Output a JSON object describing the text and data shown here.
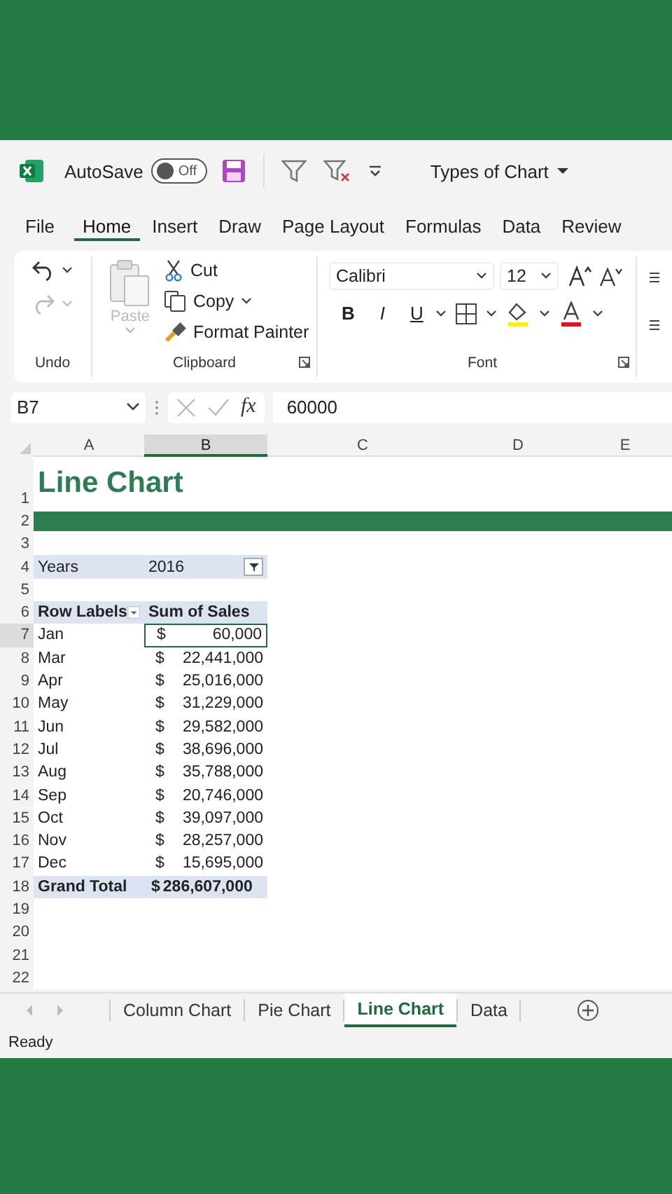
{
  "title_bar": {
    "autosave": {
      "label": "AutoSave",
      "on": false,
      "state_label": "Off"
    },
    "file_name": "Types of Chart"
  },
  "ribbon_tabs": [
    {
      "label": "File",
      "selected": false
    },
    {
      "label": "Home",
      "selected": true
    },
    {
      "label": "Insert",
      "selected": false
    },
    {
      "label": "Draw",
      "selected": false
    },
    {
      "label": "Page Layout",
      "selected": false
    },
    {
      "label": "Formulas",
      "selected": false
    },
    {
      "label": "Data",
      "selected": false
    },
    {
      "label": "Review",
      "selected": false
    }
  ],
  "ribbon": {
    "undo": {
      "label": "Undo",
      "redo_disabled": true
    },
    "clipboard": {
      "label": "Clipboard",
      "paste": {
        "label": "Paste",
        "disabled": true
      },
      "cut": "Cut",
      "copy": "Copy",
      "format_painter": "Format Painter"
    },
    "font": {
      "label": "Font",
      "font_name": "Calibri",
      "font_size": "12",
      "format_buttons": [
        "B",
        "I",
        "U"
      ]
    }
  },
  "formula_bar": {
    "cell_ref": "B7",
    "function_label": "fx",
    "value": "60000"
  },
  "columns": [
    {
      "label": "A",
      "selected": false
    },
    {
      "label": "B",
      "selected": true
    },
    {
      "label": "C",
      "selected": false
    },
    {
      "label": "D",
      "selected": false
    },
    {
      "label": "E",
      "selected": false
    }
  ],
  "rows": [
    {
      "header": "1",
      "kind": "title",
      "cells": [
        "Line Chart"
      ]
    },
    {
      "header": "2",
      "kind": "band"
    },
    {
      "header": "3",
      "kind": "empty"
    },
    {
      "header": "4",
      "kind": "filter",
      "cells": [
        "Years",
        "2016"
      ]
    },
    {
      "header": "5",
      "kind": "empty"
    },
    {
      "header": "6",
      "kind": "pivot_header",
      "cells": [
        "Row Labels",
        "Sum of Sales"
      ]
    },
    {
      "header": "7",
      "kind": "value",
      "selected": true,
      "cells": [
        "Jan",
        "$",
        "60,000"
      ]
    },
    {
      "header": "8",
      "kind": "value",
      "selected": false,
      "cells": [
        "Mar",
        "$",
        "22,441,000"
      ]
    },
    {
      "header": "9",
      "kind": "value",
      "selected": false,
      "cells": [
        "Apr",
        "$",
        "25,016,000"
      ]
    },
    {
      "header": "10",
      "kind": "value",
      "selected": false,
      "cells": [
        "May",
        "$",
        "31,229,000"
      ]
    },
    {
      "header": "11",
      "kind": "value",
      "selected": false,
      "cells": [
        "Jun",
        "$",
        "29,582,000"
      ]
    },
    {
      "header": "12",
      "kind": "value",
      "selected": false,
      "cells": [
        "Jul",
        "$",
        "38,696,000"
      ]
    },
    {
      "header": "13",
      "kind": "value",
      "selected": false,
      "cells": [
        "Aug",
        "$",
        "35,788,000"
      ]
    },
    {
      "header": "14",
      "kind": "value",
      "selected": false,
      "cells": [
        "Sep",
        "$",
        "20,746,000"
      ]
    },
    {
      "header": "15",
      "kind": "value",
      "selected": false,
      "cells": [
        "Oct",
        "$",
        "39,097,000"
      ]
    },
    {
      "header": "16",
      "kind": "value",
      "selected": false,
      "cells": [
        "Nov",
        "$",
        "28,257,000"
      ]
    },
    {
      "header": "17",
      "kind": "value",
      "selected": false,
      "cells": [
        "Dec",
        "$",
        "15,695,000"
      ]
    },
    {
      "header": "18",
      "kind": "total",
      "cells": [
        "Grand Total",
        "$",
        "286,607,000"
      ]
    },
    {
      "header": "19",
      "kind": "empty"
    },
    {
      "header": "20",
      "kind": "empty"
    },
    {
      "header": "21",
      "kind": "empty"
    },
    {
      "header": "22",
      "kind": "empty"
    }
  ],
  "sheet_tabs": [
    {
      "label": "Column Chart",
      "selected": false
    },
    {
      "label": "Pie Chart",
      "selected": false
    },
    {
      "label": "Line Chart",
      "selected": true
    },
    {
      "label": "Data",
      "selected": false
    }
  ],
  "status_bar": {
    "text": "Ready"
  }
}
